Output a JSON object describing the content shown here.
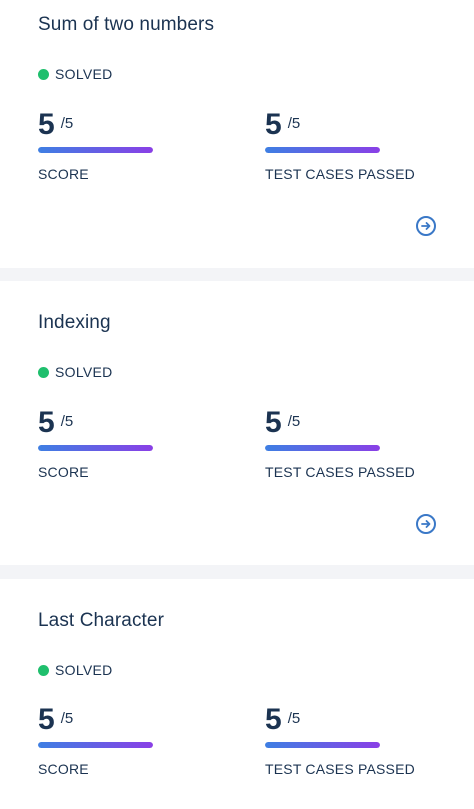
{
  "submissions": [
    {
      "title": "Sum of two numbers",
      "status": "SOLVED",
      "score": {
        "value": "5",
        "total": "/5",
        "label": "SCORE",
        "fraction": 1.0
      },
      "test_cases": {
        "value": "5",
        "total": "/5",
        "label": "TEST CASES PASSED",
        "fraction": 1.0
      },
      "action_icon": "arrow-right-circle-icon"
    },
    {
      "title": "Indexing",
      "status": "SOLVED",
      "score": {
        "value": "5",
        "total": "/5",
        "label": "SCORE",
        "fraction": 1.0
      },
      "test_cases": {
        "value": "5",
        "total": "/5",
        "label": "TEST CASES PASSED",
        "fraction": 1.0
      },
      "action_icon": "arrow-right-circle-icon"
    },
    {
      "title": "Last Character",
      "status": "SOLVED",
      "score": {
        "value": "5",
        "total": "/5",
        "label": "SCORE",
        "fraction": 1.0
      },
      "test_cases": {
        "value": "5",
        "total": "/5",
        "label": "TEST CASES PASSED",
        "fraction": 1.0
      }
    }
  ],
  "colors": {
    "status_solved": "#1fbf6d",
    "text_primary": "#1b3351",
    "accent": "#3a78c7",
    "progress_start": "#3e7fe3",
    "progress_end": "#8a3fe6"
  }
}
